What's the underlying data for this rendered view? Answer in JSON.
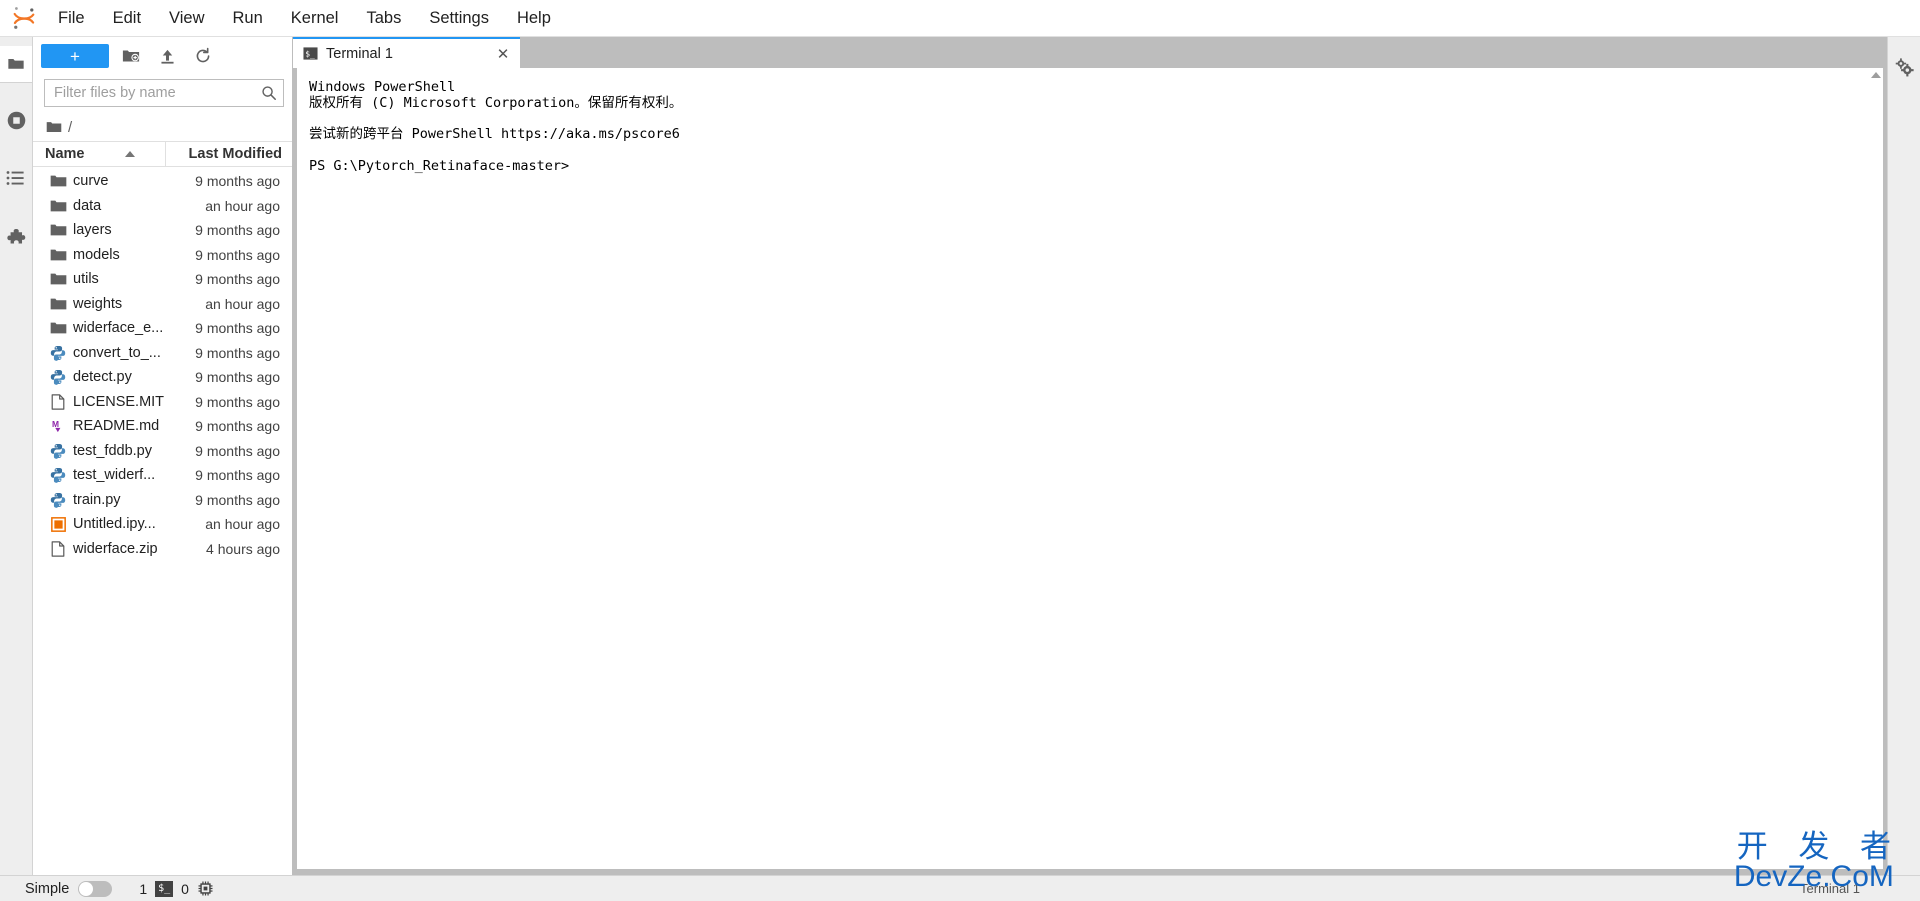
{
  "app": {
    "logo_icon": "jupyter-logo",
    "menus": [
      "File",
      "Edit",
      "View",
      "Run",
      "Kernel",
      "Tabs",
      "Settings",
      "Help"
    ]
  },
  "activity_bar": {
    "items": [
      {
        "name": "file-browser",
        "icon": "folder-icon",
        "active": true
      },
      {
        "name": "running-terminals-kernels",
        "icon": "stop-circle-icon",
        "active": false
      },
      {
        "name": "commands",
        "icon": "list-icon",
        "active": false
      },
      {
        "name": "extension-manager",
        "icon": "puzzle-icon",
        "active": false
      }
    ]
  },
  "right_bar": {
    "items": [
      {
        "name": "property-inspector",
        "icon": "gears-icon"
      }
    ]
  },
  "file_browser": {
    "toolbar": {
      "new_launcher_label": "+",
      "new_folder_icon": "new-folder-icon",
      "upload_icon": "upload-icon",
      "refresh_icon": "refresh-icon"
    },
    "filter": {
      "placeholder": "Filter files by name",
      "value": "",
      "search_icon": "search-icon"
    },
    "breadcrumb": {
      "home_icon": "folder-icon",
      "path": "/"
    },
    "columns": {
      "name": "Name",
      "last_modified": "Last Modified",
      "sort_direction": "ascending"
    },
    "items": [
      {
        "name": "curve",
        "icon": "folder-icon",
        "modified": "9 months ago"
      },
      {
        "name": "data",
        "icon": "folder-icon",
        "modified": "an hour ago"
      },
      {
        "name": "layers",
        "icon": "folder-icon",
        "modified": "9 months ago"
      },
      {
        "name": "models",
        "icon": "folder-icon",
        "modified": "9 months ago"
      },
      {
        "name": "utils",
        "icon": "folder-icon",
        "modified": "9 months ago"
      },
      {
        "name": "weights",
        "icon": "folder-icon",
        "modified": "an hour ago"
      },
      {
        "name": "widerface_e...",
        "icon": "folder-icon",
        "modified": "9 months ago"
      },
      {
        "name": "convert_to_...",
        "icon": "python-icon",
        "modified": "9 months ago"
      },
      {
        "name": "detect.py",
        "icon": "python-icon",
        "modified": "9 months ago"
      },
      {
        "name": "LICENSE.MIT",
        "icon": "file-icon",
        "modified": "9 months ago"
      },
      {
        "name": "README.md",
        "icon": "markdown-icon",
        "modified": "9 months ago"
      },
      {
        "name": "test_fddb.py",
        "icon": "python-icon",
        "modified": "9 months ago"
      },
      {
        "name": "test_widerf...",
        "icon": "python-icon",
        "modified": "9 months ago"
      },
      {
        "name": "train.py",
        "icon": "python-icon",
        "modified": "9 months ago"
      },
      {
        "name": "Untitled.ipy...",
        "icon": "notebook-icon",
        "modified": "an hour ago"
      },
      {
        "name": "widerface.zip",
        "icon": "file-icon",
        "modified": "4 hours ago"
      }
    ]
  },
  "dock": {
    "tabs": [
      {
        "label": "Terminal 1",
        "icon": "terminal-icon",
        "active": true,
        "close_icon": "close-icon"
      }
    ]
  },
  "terminal": {
    "lines": [
      "Windows PowerShell",
      "版权所有 (C) Microsoft Corporation。保留所有权利。",
      "",
      "尝试新的跨平台 PowerShell https://aka.ms/pscore6",
      "",
      "PS G:\\Pytorch_Retinaface-master>"
    ],
    "scrollbar_up_icon": "caret-up-icon"
  },
  "status_bar": {
    "simple_label": "Simple",
    "simple_enabled": false,
    "kernel_count": "1",
    "terminal_icon": "terminal-icon",
    "terminal_count": "0",
    "cpu_icon": "cpu-icon",
    "context_label": "Terminal 1"
  },
  "watermark": {
    "line1": "开 发 者",
    "line2": "DevZe.CoM",
    "color": "#1565c0"
  },
  "colors": {
    "accent": "#2196f3",
    "chrome": "#bdbdbd",
    "sidebar": "#eeeeee",
    "python_blue": "#386ea0",
    "markdown_purple": "#8e24aa",
    "notebook_orange": "#ee6f00"
  }
}
